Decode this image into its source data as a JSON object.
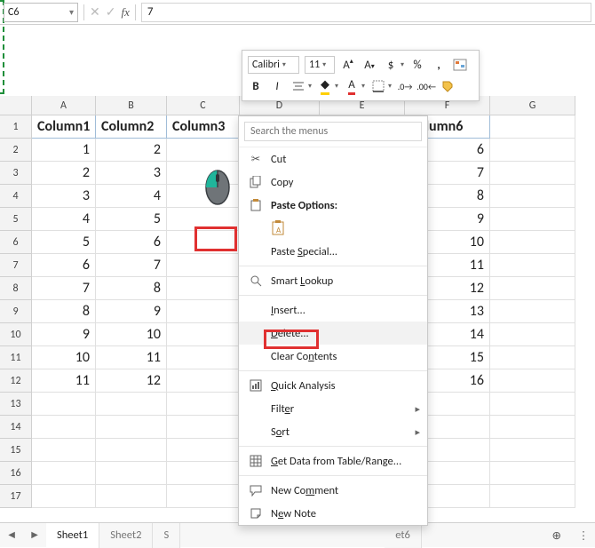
{
  "namebox": {
    "value": "C6"
  },
  "formula_bar": {
    "value": "7"
  },
  "mini_toolbar": {
    "font_name": "Calibri",
    "font_size": "11"
  },
  "columns": [
    "A",
    "B",
    "C",
    "D",
    "E",
    "F",
    "G"
  ],
  "col_widths": {
    "A": 72,
    "B": 80,
    "C": 82,
    "D": 90,
    "E": 96,
    "F": 96,
    "G": 96
  },
  "row_numbers": [
    1,
    2,
    3,
    4,
    5,
    6,
    7,
    8,
    9,
    10,
    11,
    12,
    13,
    14,
    15,
    16,
    17
  ],
  "table": {
    "headers": [
      "Column1",
      "Column2",
      "Column3",
      "",
      "",
      "Column6",
      ""
    ],
    "rows": [
      [
        "1",
        "2",
        "",
        "",
        "",
        "6",
        ""
      ],
      [
        "2",
        "3",
        "",
        "",
        "",
        "7",
        ""
      ],
      [
        "3",
        "4",
        "",
        "",
        "",
        "8",
        ""
      ],
      [
        "4",
        "5",
        "",
        "",
        "",
        "9",
        ""
      ],
      [
        "5",
        "6",
        "",
        "",
        "",
        "10",
        ""
      ],
      [
        "6",
        "7",
        "",
        "",
        "",
        "11",
        ""
      ],
      [
        "7",
        "8",
        "",
        "",
        "",
        "12",
        ""
      ],
      [
        "8",
        "9",
        "",
        "",
        "",
        "13",
        ""
      ],
      [
        "9",
        "10",
        "",
        "",
        "",
        "14",
        ""
      ],
      [
        "10",
        "11",
        "",
        "",
        "",
        "15",
        ""
      ],
      [
        "11",
        "12",
        "",
        "",
        "",
        "16",
        ""
      ],
      [
        "",
        "",
        "",
        "",
        "",
        "",
        ""
      ],
      [
        "",
        "",
        "",
        "",
        "",
        "",
        ""
      ],
      [
        "",
        "",
        "",
        "",
        "",
        "",
        ""
      ],
      [
        "",
        "",
        "",
        "",
        "",
        "",
        ""
      ],
      [
        "",
        "",
        "",
        "",
        "",
        "",
        ""
      ]
    ]
  },
  "context_menu": {
    "search_placeholder": "Search the menus",
    "items": {
      "cut": "Cut",
      "copy": "Copy",
      "paste_options": "Paste Options:",
      "paste_special": "Paste Special...",
      "smart_lookup": "Smart Lookup",
      "insert": "Insert...",
      "delete": "Delete...",
      "clear_contents": "Clear Contents",
      "quick_analysis": "Quick Analysis",
      "filter": "Filter",
      "sort": "Sort",
      "get_data": "Get Data from Table/Range...",
      "new_comment": "New Comment",
      "new_note": "New Note"
    }
  },
  "sheet_tabs": {
    "tabs": [
      "Sheet1",
      "Sheet2",
      "S",
      "et6"
    ]
  }
}
